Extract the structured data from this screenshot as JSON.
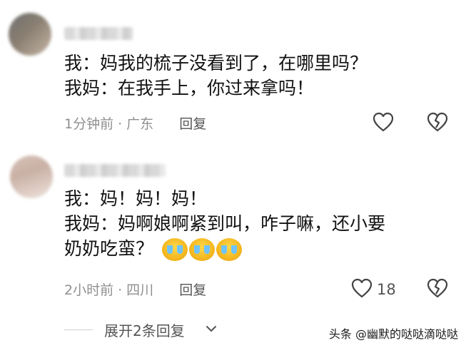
{
  "comments": [
    {
      "lines": [
        "我：妈我的梳子没看到了，在哪里吗？",
        "我妈：在我手上，你过来拿吗！"
      ],
      "time": "1分钟前",
      "location": "广东",
      "reply_label": "回复"
    },
    {
      "lines": [
        "我：妈！妈！妈！",
        "我妈：妈啊娘啊紧到叫，咋子嘛，还小要",
        "奶奶吃蛮？"
      ],
      "time": "2小时前",
      "location": "四川",
      "reply_label": "回复",
      "like_count": "18"
    }
  ],
  "meta_separator": "·",
  "expand_label": "展开2条回复",
  "watermark": "头条 @幽默的哒哒滴哒哒",
  "icons": [
    "heart-outline-icon",
    "broken-heart-icon",
    "chevron-down-icon",
    "crying-emoji-icon"
  ]
}
